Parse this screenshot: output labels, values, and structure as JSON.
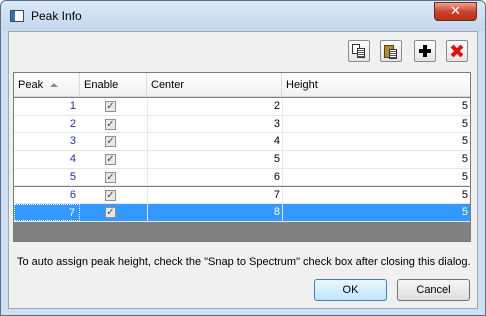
{
  "window": {
    "title": "Peak Info",
    "close_label": "✕"
  },
  "toolbar": {
    "copy_icon": "copy-icon",
    "paste_icon": "paste-icon",
    "add_icon": "plus-icon",
    "delete_icon": "delete-x-icon",
    "delete_color": "#e01010"
  },
  "table": {
    "columns": [
      "Peak",
      "Enable",
      "Center",
      "Height"
    ],
    "rows": [
      {
        "peak": "1",
        "enable": true,
        "center": "2",
        "height": "5"
      },
      {
        "peak": "2",
        "enable": true,
        "center": "3",
        "height": "5"
      },
      {
        "peak": "3",
        "enable": true,
        "center": "4",
        "height": "5"
      },
      {
        "peak": "4",
        "enable": true,
        "center": "5",
        "height": "5"
      },
      {
        "peak": "5",
        "enable": true,
        "center": "6",
        "height": "5"
      },
      {
        "peak": "6",
        "enable": true,
        "center": "7",
        "height": "5"
      },
      {
        "peak": "7",
        "enable": true,
        "center": "8",
        "height": "5"
      }
    ],
    "selected_row": 7,
    "check_glyph": "✓",
    "selection_color": "#3399ff"
  },
  "hint": "To auto assign peak height, check the \"Snap to Spectrum\" check box after closing this dialog.",
  "buttons": {
    "ok": "OK",
    "cancel": "Cancel"
  }
}
